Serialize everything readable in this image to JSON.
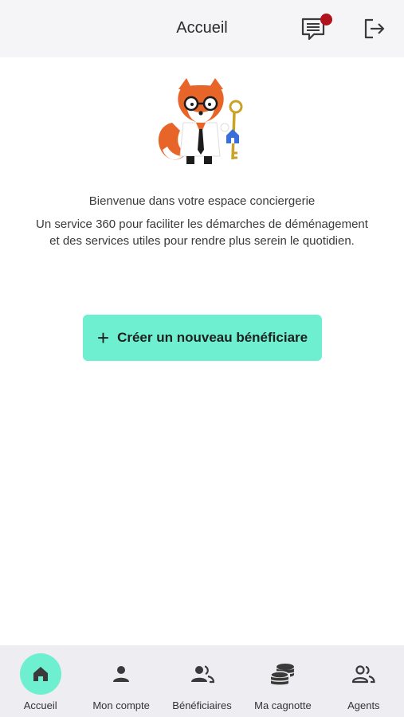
{
  "header": {
    "title": "Accueil",
    "messages_icon": "messages-icon",
    "logout_icon": "logout-icon",
    "notification_color": "#b0131b"
  },
  "main": {
    "mascot": "fox-concierge-illustration",
    "welcome": "Bienvenue dans votre espace conciergerie",
    "tagline_line1": "Un service 360 pour faciliter les démarches de déménagement",
    "tagline_line2": "et des services utiles pour rendre plus serein le quotidien.",
    "create_button": {
      "icon": "plus-icon",
      "label": "Créer un nouveau bénéficiare"
    }
  },
  "nav": {
    "accent_color": "#6ef0d0",
    "items": [
      {
        "label": "Accueil",
        "icon": "home-icon",
        "active": true
      },
      {
        "label": "Mon compte",
        "icon": "user-icon"
      },
      {
        "label": "Bénéficiaires",
        "icon": "users-icon"
      },
      {
        "label": "Ma cagnotte",
        "icon": "coins-icon"
      },
      {
        "label": "Agents",
        "icon": "agents-icon"
      }
    ]
  }
}
